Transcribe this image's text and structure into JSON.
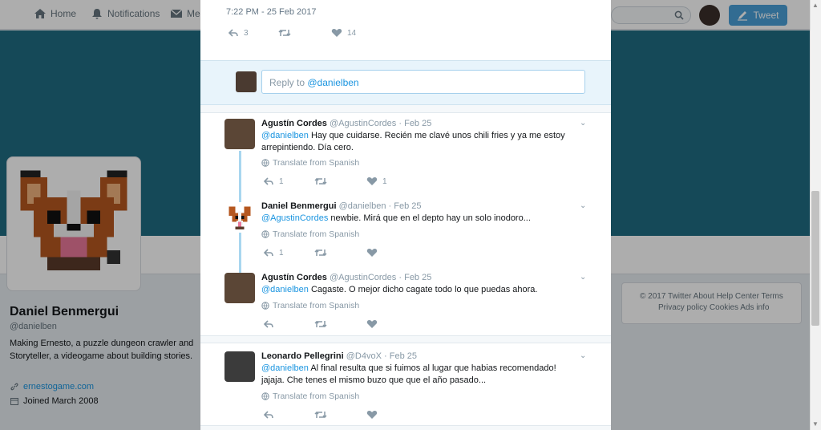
{
  "topbar": {
    "home": "Home",
    "notifications": "Notifications",
    "messages": "Mes",
    "tweet_button": "Tweet"
  },
  "profile": {
    "name": "Daniel Benmergui",
    "handle": "@danielben",
    "bio": "Making Ernesto, a puzzle dungeon crawler and Storyteller, a videogame about building stories.",
    "link": "ernestogame.com",
    "joined": "Joined March 2008"
  },
  "footer": {
    "line1": "© 2017 Twitter   About   Help Center   Terms",
    "line2": "Privacy policy   Cookies   Ads info"
  },
  "main_tweet": {
    "timestamp": "7:22 PM - 25 Feb 2017",
    "replies": "3",
    "likes": "14"
  },
  "reply_box": {
    "placeholder_prefix": "Reply to ",
    "mention": "@danielben"
  },
  "replies": [
    {
      "name": "Agustín Cordes",
      "handle": "@AgustinCordes",
      "date": "Feb 25",
      "mention": "@danielben",
      "text": " Hay que cuidarse. Recién me clavé unos chili fries y ya me estoy arrepintiendo. Día cero.",
      "translate": "Translate from Spanish",
      "reply_count": "1",
      "like_count": "1"
    },
    {
      "name": "Daniel Benmergui",
      "handle": "@danielben",
      "date": "Feb 25",
      "mention": "@AgustinCordes",
      "text": " newbie. Mirá que en el depto hay un solo inodoro...",
      "translate": "Translate from Spanish",
      "reply_count": "1",
      "like_count": ""
    },
    {
      "name": "Agustín Cordes",
      "handle": "@AgustinCordes",
      "date": "Feb 25",
      "mention": "@danielben",
      "text": " Cagaste. O mejor dicho cagate todo lo que puedas ahora.",
      "translate": "Translate from Spanish",
      "reply_count": "",
      "like_count": ""
    },
    {
      "name": "Leonardo Pellegrini",
      "handle": "@D4voX",
      "date": "Feb 25",
      "mention": "@danielben",
      "text": " Al final resulta que si fuimos al lugar que habias recomendado! jajaja. Che tenes el mismo buzo que que el año pasado...",
      "translate": "Translate from Spanish",
      "reply_count": "",
      "like_count": ""
    }
  ],
  "colors": {
    "accent": "#1b95e0",
    "banner": "#1f6c82",
    "tweet_button": "#4aa0d8",
    "thread_line": "#a8d6ef"
  }
}
